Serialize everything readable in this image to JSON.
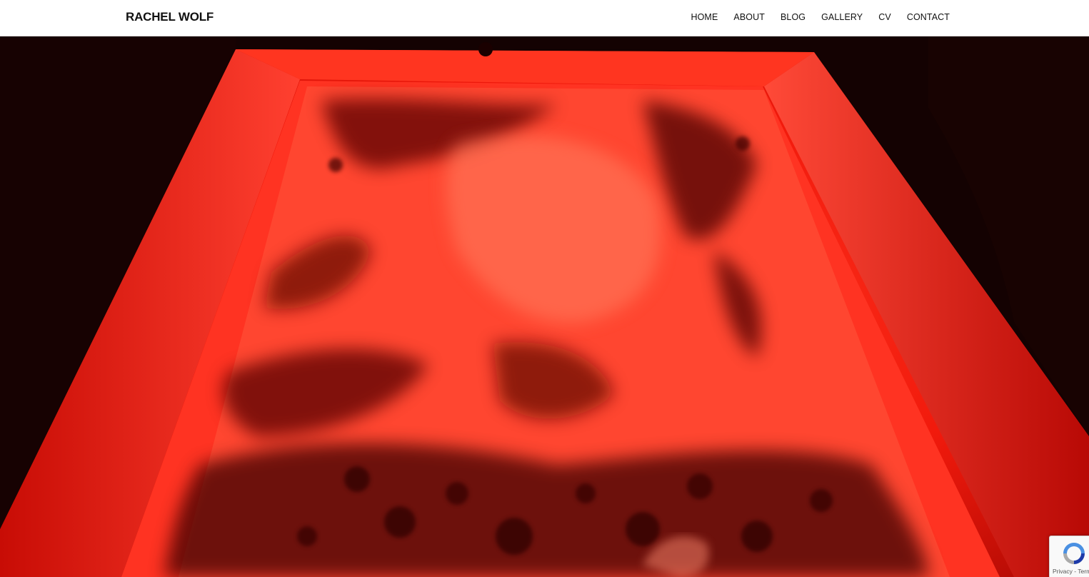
{
  "site": {
    "title": "RACHEL WOLF"
  },
  "nav": {
    "items": [
      {
        "label": "HOME"
      },
      {
        "label": "ABOUT"
      },
      {
        "label": "BLOG"
      },
      {
        "label": "GALLERY"
      },
      {
        "label": "CV"
      },
      {
        "label": "CONTACT"
      }
    ]
  },
  "recaptcha": {
    "links": "Privacy - Terms"
  },
  "colors": {
    "header_bg": "#ffffff",
    "hero_red": "#ff2a1a",
    "hero_dark": "#120101"
  },
  "icons": {
    "recaptcha": "recaptcha-logo-icon"
  }
}
